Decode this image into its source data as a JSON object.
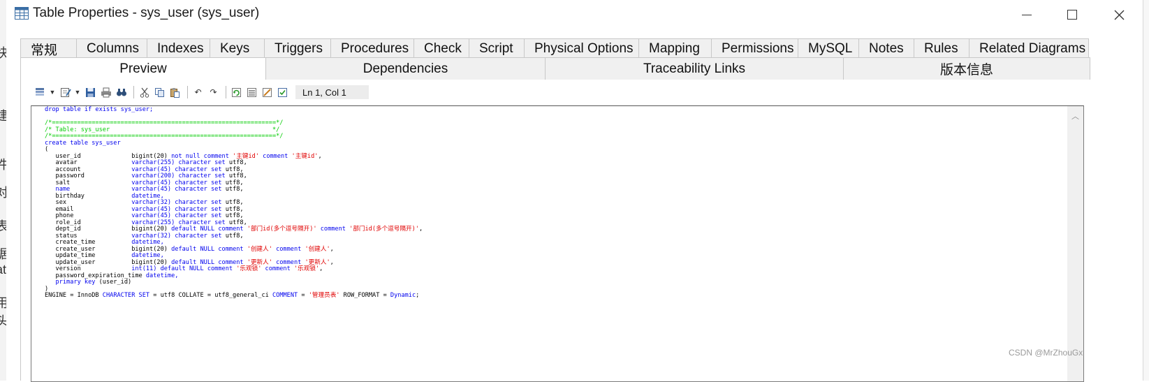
{
  "window": {
    "title": "Table Properties - sys_user (sys_user)",
    "minimize_glyph": "—",
    "maximize_glyph": "☐",
    "close_glyph": "✕"
  },
  "background_app": {
    "chars": [
      "快",
      "建",
      "件",
      "对",
      "表",
      "据",
      "at",
      "用",
      "头"
    ]
  },
  "tabs_row1": [
    {
      "label": "常规"
    },
    {
      "label": "Columns"
    },
    {
      "label": "Indexes"
    },
    {
      "label": "Keys"
    },
    {
      "label": "Triggers"
    },
    {
      "label": "Procedures"
    },
    {
      "label": "Check"
    },
    {
      "label": "Script"
    },
    {
      "label": "Physical Options"
    },
    {
      "label": "Mapping"
    },
    {
      "label": "Permissions"
    },
    {
      "label": "MySQL"
    },
    {
      "label": "Notes"
    },
    {
      "label": "Rules"
    },
    {
      "label": "Related Diagrams"
    }
  ],
  "tabs_row2": [
    {
      "label": "Preview",
      "active": true
    },
    {
      "label": "Dependencies"
    },
    {
      "label": "Traceability Links"
    },
    {
      "label": "版本信息"
    }
  ],
  "toolbar": {
    "icons": [
      "sql-menu-icon",
      "edit-menu-icon",
      "save-icon",
      "print-icon",
      "find-icon",
      "cut-icon",
      "copy-icon",
      "paste-icon",
      "undo-icon",
      "redo-icon",
      "refresh-icon",
      "show-generation-options-icon",
      "edit-generation-options-icon",
      "preview-options-icon"
    ],
    "cursor_position": "Ln 1, Col 1"
  },
  "code": {
    "lines": [
      [
        {
          "t": "drop table if exists sys_user;",
          "c": "kw-drop"
        }
      ],
      [
        {
          "t": "",
          "c": ""
        }
      ],
      [
        {
          "t": "/*==============================================================*/",
          "c": "cmt"
        }
      ],
      [
        {
          "t": "/* Table: sys_user                                             */",
          "c": "cmt"
        }
      ],
      [
        {
          "t": "/*==============================================================*/",
          "c": "cmt"
        }
      ],
      [
        {
          "t": "create table sys_user",
          "c": "kw"
        }
      ],
      [
        {
          "t": "(",
          "c": ""
        }
      ],
      [
        {
          "t": "   user_id              ",
          "c": ""
        },
        {
          "t": "bigint(20) ",
          "c": ""
        },
        {
          "t": "not null comment ",
          "c": "kw"
        },
        {
          "t": "'主键id'",
          "c": "str"
        },
        {
          "t": " comment ",
          "c": "kw"
        },
        {
          "t": "'主键id'",
          "c": "str"
        },
        {
          "t": ",",
          "c": ""
        }
      ],
      [
        {
          "t": "   avatar               ",
          "c": ""
        },
        {
          "t": "varchar(255) character set ",
          "c": "kw"
        },
        {
          "t": "utf8,",
          "c": ""
        }
      ],
      [
        {
          "t": "   account              ",
          "c": ""
        },
        {
          "t": "varchar(45) character set ",
          "c": "kw"
        },
        {
          "t": "utf8,",
          "c": ""
        }
      ],
      [
        {
          "t": "   password             ",
          "c": ""
        },
        {
          "t": "varchar(200) character set ",
          "c": "kw"
        },
        {
          "t": "utf8,",
          "c": ""
        }
      ],
      [
        {
          "t": "   salt                 ",
          "c": ""
        },
        {
          "t": "varchar(45) character set ",
          "c": "kw"
        },
        {
          "t": "utf8,",
          "c": ""
        }
      ],
      [
        {
          "t": "   name                 ",
          "c": "kw"
        },
        {
          "t": "varchar(45) character set ",
          "c": "kw"
        },
        {
          "t": "utf8,",
          "c": ""
        }
      ],
      [
        {
          "t": "   birthday             ",
          "c": ""
        },
        {
          "t": "datetime,",
          "c": "kw"
        }
      ],
      [
        {
          "t": "   sex                  ",
          "c": ""
        },
        {
          "t": "varchar(32) character set ",
          "c": "kw"
        },
        {
          "t": "utf8,",
          "c": ""
        }
      ],
      [
        {
          "t": "   email                ",
          "c": ""
        },
        {
          "t": "varchar(45) character set ",
          "c": "kw"
        },
        {
          "t": "utf8,",
          "c": ""
        }
      ],
      [
        {
          "t": "   phone                ",
          "c": ""
        },
        {
          "t": "varchar(45) character set ",
          "c": "kw"
        },
        {
          "t": "utf8,",
          "c": ""
        }
      ],
      [
        {
          "t": "   role_id              ",
          "c": ""
        },
        {
          "t": "varchar(255) character set ",
          "c": "kw"
        },
        {
          "t": "utf8,",
          "c": ""
        }
      ],
      [
        {
          "t": "   dept_id              ",
          "c": ""
        },
        {
          "t": "bigint(20) ",
          "c": ""
        },
        {
          "t": "default NULL comment ",
          "c": "kw"
        },
        {
          "t": "'部门id(多个逗号隔开)'",
          "c": "str"
        },
        {
          "t": " comment ",
          "c": "kw"
        },
        {
          "t": "'部门id(多个逗号隔开)'",
          "c": "str"
        },
        {
          "t": ",",
          "c": ""
        }
      ],
      [
        {
          "t": "   status               ",
          "c": ""
        },
        {
          "t": "varchar(32) character set ",
          "c": "kw"
        },
        {
          "t": "utf8,",
          "c": ""
        }
      ],
      [
        {
          "t": "   create_time          ",
          "c": ""
        },
        {
          "t": "datetime,",
          "c": "kw"
        }
      ],
      [
        {
          "t": "   create_user          ",
          "c": ""
        },
        {
          "t": "bigint(20) ",
          "c": ""
        },
        {
          "t": "default NULL comment ",
          "c": "kw"
        },
        {
          "t": "'创建人'",
          "c": "str"
        },
        {
          "t": " comment ",
          "c": "kw"
        },
        {
          "t": "'创建人'",
          "c": "str"
        },
        {
          "t": ",",
          "c": ""
        }
      ],
      [
        {
          "t": "   update_time          ",
          "c": ""
        },
        {
          "t": "datetime,",
          "c": "kw"
        }
      ],
      [
        {
          "t": "   update_user          ",
          "c": ""
        },
        {
          "t": "bigint(20) ",
          "c": ""
        },
        {
          "t": "default NULL comment ",
          "c": "kw"
        },
        {
          "t": "'更新人'",
          "c": "str"
        },
        {
          "t": " comment ",
          "c": "kw"
        },
        {
          "t": "'更新人'",
          "c": "str"
        },
        {
          "t": ",",
          "c": ""
        }
      ],
      [
        {
          "t": "   version              ",
          "c": ""
        },
        {
          "t": "int(11) default NULL comment ",
          "c": "kw"
        },
        {
          "t": "'乐观锁'",
          "c": "str"
        },
        {
          "t": " comment ",
          "c": "kw"
        },
        {
          "t": "'乐观锁'",
          "c": "str"
        },
        {
          "t": ",",
          "c": ""
        }
      ],
      [
        {
          "t": "   password_expiration_time ",
          "c": ""
        },
        {
          "t": "datetime,",
          "c": "kw"
        }
      ],
      [
        {
          "t": "   primary key ",
          "c": "kw"
        },
        {
          "t": "(user_id)",
          "c": ""
        }
      ],
      [
        {
          "t": ")",
          "c": ""
        }
      ],
      [
        {
          "t": "ENGINE = InnoDB ",
          "c": ""
        },
        {
          "t": "CHARACTER SET ",
          "c": "kw"
        },
        {
          "t": "= utf8 COLLATE = utf8_general_ci ",
          "c": ""
        },
        {
          "t": "COMMENT ",
          "c": "kw"
        },
        {
          "t": "= ",
          "c": ""
        },
        {
          "t": "'管理员表'",
          "c": "str"
        },
        {
          "t": " ROW_FORMAT = ",
          "c": ""
        },
        {
          "t": "Dynamic",
          "c": "kw"
        },
        {
          "t": ";",
          "c": ""
        }
      ]
    ]
  },
  "watermark": "CSDN @MrZhouGx",
  "colors": {
    "keyword": "#0000ee",
    "string": "#e00000",
    "comment": "#00cc00",
    "tab_bg": "#f0f0f0"
  }
}
